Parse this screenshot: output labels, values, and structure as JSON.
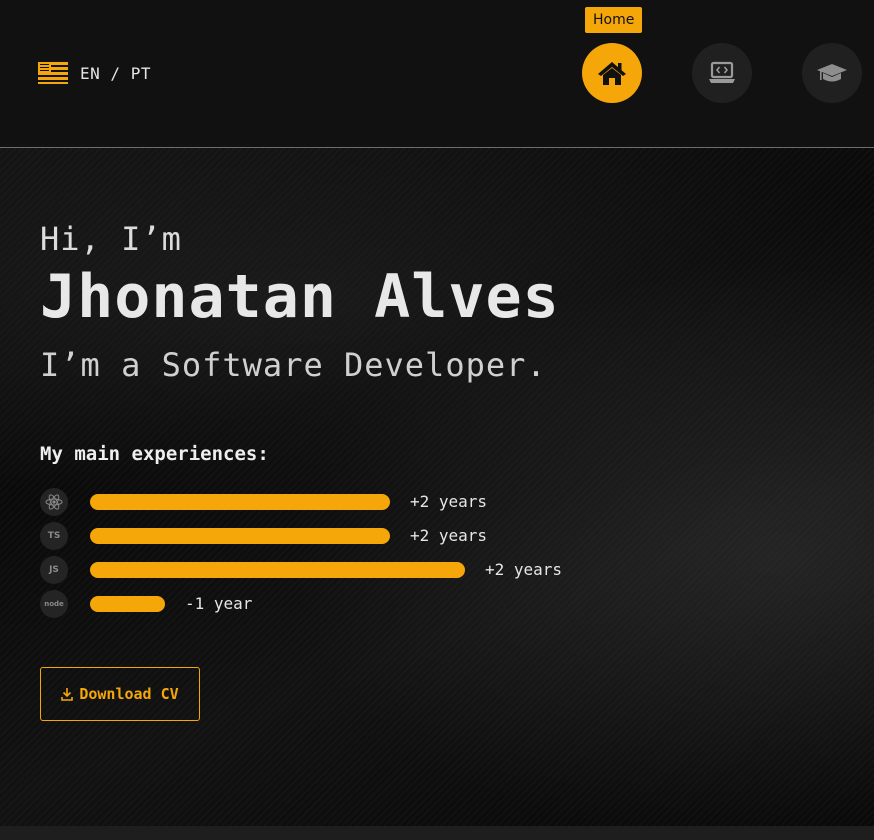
{
  "header": {
    "language": {
      "current": "EN",
      "separator": "/",
      "other": "PT",
      "flag_icon": "us-flag-icon"
    },
    "nav": [
      {
        "name": "nav-home",
        "icon": "home-icon",
        "tooltip": "Home",
        "active": true
      },
      {
        "name": "nav-projects",
        "icon": "laptop-code-icon",
        "active": false
      },
      {
        "name": "nav-education",
        "icon": "graduation-cap-icon",
        "active": false
      }
    ]
  },
  "hero": {
    "greeting": "Hi, I’m",
    "name": "Jhonatan Alves",
    "role": "I’m a Software Developer."
  },
  "experiences": {
    "title": "My main experiences:",
    "items": [
      {
        "tech": "React",
        "icon": "react-icon",
        "level": 0.8,
        "label": "+2 years"
      },
      {
        "tech": "TypeScript",
        "icon": "typescript-icon",
        "badge": "TS",
        "level": 0.8,
        "label": "+2 years"
      },
      {
        "tech": "JavaScript",
        "icon": "javascript-icon",
        "badge": "JS",
        "level": 1.0,
        "label": "+2 years"
      },
      {
        "tech": "Node.js",
        "icon": "nodejs-icon",
        "badge": "node",
        "level": 0.2,
        "label": "-1 year"
      }
    ]
  },
  "cv": {
    "label": "Download CV",
    "icon": "download-icon"
  },
  "colors": {
    "accent": "#f5a70a",
    "background": "#0c0c0c",
    "header": "#111111",
    "text": "#e6e6e6"
  }
}
